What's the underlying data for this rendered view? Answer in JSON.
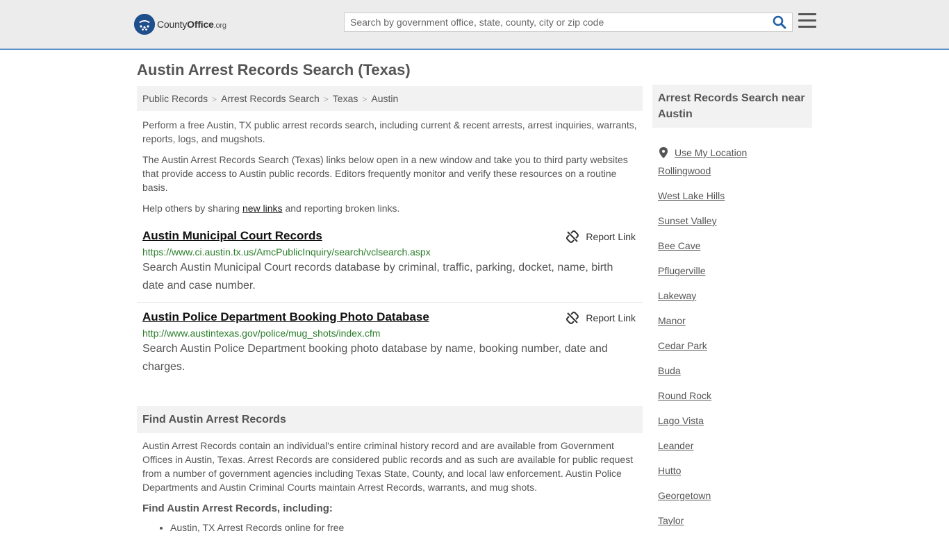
{
  "header": {
    "logo_name": "County",
    "logo_name2": "Office",
    "logo_tld": ".org",
    "search_placeholder": "Search by government office, state, county, city or zip code"
  },
  "page_title": "Austin Arrest Records Search (Texas)",
  "breadcrumb": [
    "Public Records",
    "Arrest Records Search",
    "Texas",
    "Austin"
  ],
  "intro": {
    "p1": "Perform a free Austin, TX public arrest records search, including current & recent arrests, arrest inquiries, warrants, reports, logs, and mugshots.",
    "p2": "The Austin Arrest Records Search (Texas) links below open in a new window and take you to third party websites that provide access to Austin public records. Editors frequently monitor and verify these resources on a routine basis.",
    "p3_before": "Help others by sharing ",
    "p3_link": "new links",
    "p3_after": " and reporting broken links."
  },
  "results": [
    {
      "title": "Austin Municipal Court Records",
      "url": "https://www.ci.austin.tx.us/AmcPublicInquiry/search/vclsearch.aspx",
      "description": "Search Austin Municipal Court records database by criminal, traffic, parking, docket, name, birth date and case number.",
      "report_label": "Report Link"
    },
    {
      "title": "Austin Police Department Booking Photo Database",
      "url": "http://www.austintexas.gov/police/mug_shots/index.cfm",
      "description": "Search Austin Police Department booking photo database by name, booking number, date and charges.",
      "report_label": "Report Link"
    }
  ],
  "find_section": {
    "heading": "Find Austin Arrest Records",
    "body": "Austin Arrest Records contain an individual's entire criminal history record and are available from Government Offices in Austin, Texas. Arrest Records are considered public records and as such are available for public request from a number of government agencies including Texas State, County, and local law enforcement. Austin Police Departments and Austin Criminal Courts maintain Arrest Records, warrants, and mug shots.",
    "subheading": "Find Austin Arrest Records, including:",
    "bullets": [
      "Austin, TX Arrest Records online for free"
    ]
  },
  "sidebar": {
    "heading": "Arrest Records Search near Austin",
    "use_location": "Use My Location",
    "cities": [
      "Rollingwood",
      "West Lake Hills",
      "Sunset Valley",
      "Bee Cave",
      "Pflugerville",
      "Lakeway",
      "Manor",
      "Cedar Park",
      "Buda",
      "Round Rock",
      "Lago Vista",
      "Leander",
      "Hutto",
      "Georgetown",
      "Taylor"
    ]
  },
  "colors": {
    "header_bg": "#ececec",
    "header_border": "#5b8fc7",
    "logo_blue": "#1f4e8c",
    "url_green": "#2a7d2a"
  }
}
